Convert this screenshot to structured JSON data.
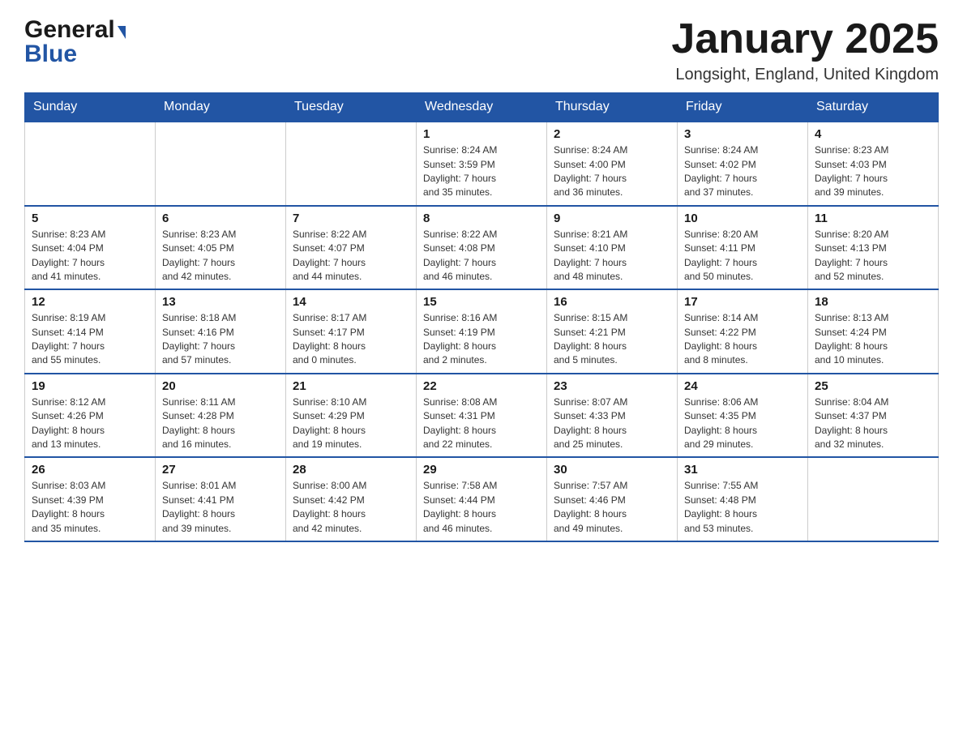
{
  "header": {
    "logo_general": "General",
    "logo_blue": "Blue",
    "title": "January 2025",
    "location": "Longsight, England, United Kingdom"
  },
  "days_of_week": [
    "Sunday",
    "Monday",
    "Tuesday",
    "Wednesday",
    "Thursday",
    "Friday",
    "Saturday"
  ],
  "weeks": [
    [
      {
        "day": "",
        "info": ""
      },
      {
        "day": "",
        "info": ""
      },
      {
        "day": "",
        "info": ""
      },
      {
        "day": "1",
        "info": "Sunrise: 8:24 AM\nSunset: 3:59 PM\nDaylight: 7 hours\nand 35 minutes."
      },
      {
        "day": "2",
        "info": "Sunrise: 8:24 AM\nSunset: 4:00 PM\nDaylight: 7 hours\nand 36 minutes."
      },
      {
        "day": "3",
        "info": "Sunrise: 8:24 AM\nSunset: 4:02 PM\nDaylight: 7 hours\nand 37 minutes."
      },
      {
        "day": "4",
        "info": "Sunrise: 8:23 AM\nSunset: 4:03 PM\nDaylight: 7 hours\nand 39 minutes."
      }
    ],
    [
      {
        "day": "5",
        "info": "Sunrise: 8:23 AM\nSunset: 4:04 PM\nDaylight: 7 hours\nand 41 minutes."
      },
      {
        "day": "6",
        "info": "Sunrise: 8:23 AM\nSunset: 4:05 PM\nDaylight: 7 hours\nand 42 minutes."
      },
      {
        "day": "7",
        "info": "Sunrise: 8:22 AM\nSunset: 4:07 PM\nDaylight: 7 hours\nand 44 minutes."
      },
      {
        "day": "8",
        "info": "Sunrise: 8:22 AM\nSunset: 4:08 PM\nDaylight: 7 hours\nand 46 minutes."
      },
      {
        "day": "9",
        "info": "Sunrise: 8:21 AM\nSunset: 4:10 PM\nDaylight: 7 hours\nand 48 minutes."
      },
      {
        "day": "10",
        "info": "Sunrise: 8:20 AM\nSunset: 4:11 PM\nDaylight: 7 hours\nand 50 minutes."
      },
      {
        "day": "11",
        "info": "Sunrise: 8:20 AM\nSunset: 4:13 PM\nDaylight: 7 hours\nand 52 minutes."
      }
    ],
    [
      {
        "day": "12",
        "info": "Sunrise: 8:19 AM\nSunset: 4:14 PM\nDaylight: 7 hours\nand 55 minutes."
      },
      {
        "day": "13",
        "info": "Sunrise: 8:18 AM\nSunset: 4:16 PM\nDaylight: 7 hours\nand 57 minutes."
      },
      {
        "day": "14",
        "info": "Sunrise: 8:17 AM\nSunset: 4:17 PM\nDaylight: 8 hours\nand 0 minutes."
      },
      {
        "day": "15",
        "info": "Sunrise: 8:16 AM\nSunset: 4:19 PM\nDaylight: 8 hours\nand 2 minutes."
      },
      {
        "day": "16",
        "info": "Sunrise: 8:15 AM\nSunset: 4:21 PM\nDaylight: 8 hours\nand 5 minutes."
      },
      {
        "day": "17",
        "info": "Sunrise: 8:14 AM\nSunset: 4:22 PM\nDaylight: 8 hours\nand 8 minutes."
      },
      {
        "day": "18",
        "info": "Sunrise: 8:13 AM\nSunset: 4:24 PM\nDaylight: 8 hours\nand 10 minutes."
      }
    ],
    [
      {
        "day": "19",
        "info": "Sunrise: 8:12 AM\nSunset: 4:26 PM\nDaylight: 8 hours\nand 13 minutes."
      },
      {
        "day": "20",
        "info": "Sunrise: 8:11 AM\nSunset: 4:28 PM\nDaylight: 8 hours\nand 16 minutes."
      },
      {
        "day": "21",
        "info": "Sunrise: 8:10 AM\nSunset: 4:29 PM\nDaylight: 8 hours\nand 19 minutes."
      },
      {
        "day": "22",
        "info": "Sunrise: 8:08 AM\nSunset: 4:31 PM\nDaylight: 8 hours\nand 22 minutes."
      },
      {
        "day": "23",
        "info": "Sunrise: 8:07 AM\nSunset: 4:33 PM\nDaylight: 8 hours\nand 25 minutes."
      },
      {
        "day": "24",
        "info": "Sunrise: 8:06 AM\nSunset: 4:35 PM\nDaylight: 8 hours\nand 29 minutes."
      },
      {
        "day": "25",
        "info": "Sunrise: 8:04 AM\nSunset: 4:37 PM\nDaylight: 8 hours\nand 32 minutes."
      }
    ],
    [
      {
        "day": "26",
        "info": "Sunrise: 8:03 AM\nSunset: 4:39 PM\nDaylight: 8 hours\nand 35 minutes."
      },
      {
        "day": "27",
        "info": "Sunrise: 8:01 AM\nSunset: 4:41 PM\nDaylight: 8 hours\nand 39 minutes."
      },
      {
        "day": "28",
        "info": "Sunrise: 8:00 AM\nSunset: 4:42 PM\nDaylight: 8 hours\nand 42 minutes."
      },
      {
        "day": "29",
        "info": "Sunrise: 7:58 AM\nSunset: 4:44 PM\nDaylight: 8 hours\nand 46 minutes."
      },
      {
        "day": "30",
        "info": "Sunrise: 7:57 AM\nSunset: 4:46 PM\nDaylight: 8 hours\nand 49 minutes."
      },
      {
        "day": "31",
        "info": "Sunrise: 7:55 AM\nSunset: 4:48 PM\nDaylight: 8 hours\nand 53 minutes."
      },
      {
        "day": "",
        "info": ""
      }
    ]
  ]
}
